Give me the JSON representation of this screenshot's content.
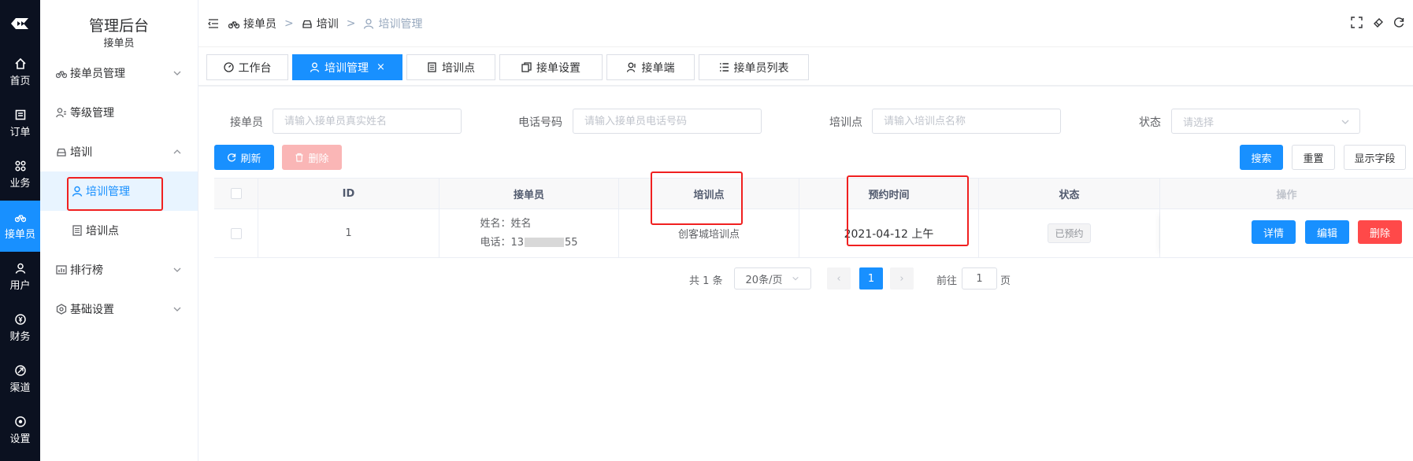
{
  "rail": {
    "items": [
      {
        "label": "首页",
        "icon": "home-icon"
      },
      {
        "label": "订单",
        "icon": "order-icon"
      },
      {
        "label": "业务",
        "icon": "grid-icon"
      },
      {
        "label": "接单员",
        "icon": "bicycle-icon",
        "active": true
      },
      {
        "label": "用户",
        "icon": "user-icon"
      },
      {
        "label": "财务",
        "icon": "finance-icon"
      },
      {
        "label": "渠道",
        "icon": "channel-icon"
      },
      {
        "label": "设置",
        "icon": "settings-icon"
      }
    ]
  },
  "sidebar": {
    "title": "管理后台",
    "subtitle": "接单员",
    "items": [
      {
        "label": "接单员管理"
      },
      {
        "label": "等级管理"
      },
      {
        "label": "培训"
      },
      {
        "label": "培训管理"
      },
      {
        "label": "培训点"
      },
      {
        "label": "排行榜"
      },
      {
        "label": "基础设置"
      }
    ]
  },
  "breadcrumb": {
    "items": [
      "接单员",
      "培训",
      "培训管理"
    ],
    "sep": ">"
  },
  "tabs": [
    {
      "label": "工作台"
    },
    {
      "label": "培训管理",
      "close": "×"
    },
    {
      "label": "培训点"
    },
    {
      "label": "接单设置"
    },
    {
      "label": "接单端"
    },
    {
      "label": "接单员列表"
    }
  ],
  "filters": {
    "rider_label": "接单员",
    "rider_placeholder": "请输入接单员真实姓名",
    "phone_label": "电话号码",
    "phone_placeholder": "请输入接单员电话号码",
    "site_label": "培训点",
    "site_placeholder": "请输入培训点名称",
    "status_label": "状态",
    "status_placeholder": "请选择"
  },
  "buttons": {
    "refresh": "刷新",
    "delete": "删除",
    "search": "搜索",
    "reset": "重置",
    "columns": "显示字段"
  },
  "table": {
    "headers": [
      "ID",
      "接单员",
      "培训点",
      "预约时间",
      "状态",
      "操作"
    ],
    "rows": [
      {
        "id": "1",
        "name_label": "姓名：",
        "name": "姓名",
        "phone_label": "电话：",
        "phone_prefix": "13",
        "phone_suffix": "55",
        "site": "创客城培训点",
        "time": "2021-04-12 上午",
        "status": "已预约",
        "actions": [
          "详情",
          "编辑",
          "删除"
        ]
      }
    ]
  },
  "pagination": {
    "total": "共 1 条",
    "page_size": "20条/页",
    "prev": "‹",
    "page": "1",
    "next": "›",
    "goto_label": "前往",
    "goto_value": "1",
    "goto_suffix": "页"
  },
  "colors": {
    "primary": "#1890ff",
    "danger": "#ff4949",
    "highlight": "#f02020",
    "rail": "#0b1120"
  }
}
